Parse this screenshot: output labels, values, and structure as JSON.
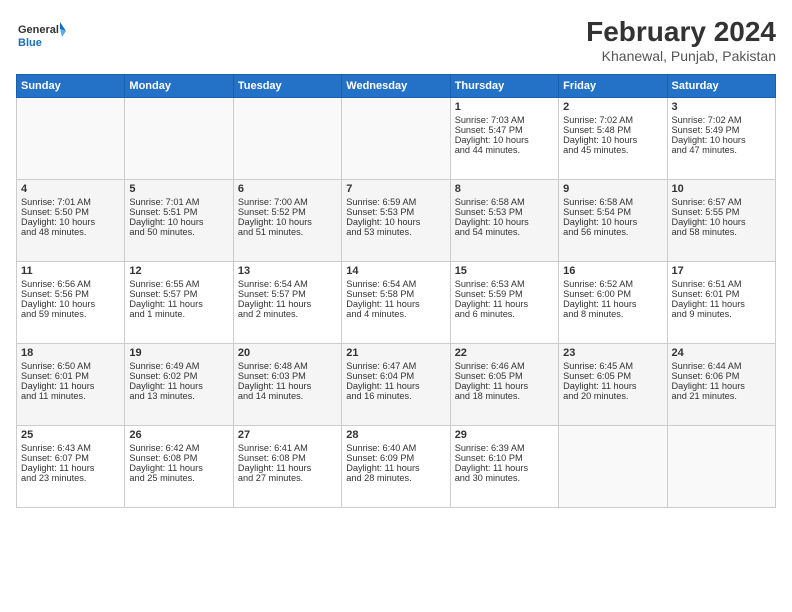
{
  "header": {
    "logo_line1": "General",
    "logo_line2": "Blue",
    "month": "February 2024",
    "location": "Khanewal, Punjab, Pakistan"
  },
  "days_of_week": [
    "Sunday",
    "Monday",
    "Tuesday",
    "Wednesday",
    "Thursday",
    "Friday",
    "Saturday"
  ],
  "weeks": [
    [
      {
        "day": "",
        "content": ""
      },
      {
        "day": "",
        "content": ""
      },
      {
        "day": "",
        "content": ""
      },
      {
        "day": "",
        "content": ""
      },
      {
        "day": "1",
        "content": "Sunrise: 7:03 AM\nSunset: 5:47 PM\nDaylight: 10 hours\nand 44 minutes."
      },
      {
        "day": "2",
        "content": "Sunrise: 7:02 AM\nSunset: 5:48 PM\nDaylight: 10 hours\nand 45 minutes."
      },
      {
        "day": "3",
        "content": "Sunrise: 7:02 AM\nSunset: 5:49 PM\nDaylight: 10 hours\nand 47 minutes."
      }
    ],
    [
      {
        "day": "4",
        "content": "Sunrise: 7:01 AM\nSunset: 5:50 PM\nDaylight: 10 hours\nand 48 minutes."
      },
      {
        "day": "5",
        "content": "Sunrise: 7:01 AM\nSunset: 5:51 PM\nDaylight: 10 hours\nand 50 minutes."
      },
      {
        "day": "6",
        "content": "Sunrise: 7:00 AM\nSunset: 5:52 PM\nDaylight: 10 hours\nand 51 minutes."
      },
      {
        "day": "7",
        "content": "Sunrise: 6:59 AM\nSunset: 5:53 PM\nDaylight: 10 hours\nand 53 minutes."
      },
      {
        "day": "8",
        "content": "Sunrise: 6:58 AM\nSunset: 5:53 PM\nDaylight: 10 hours\nand 54 minutes."
      },
      {
        "day": "9",
        "content": "Sunrise: 6:58 AM\nSunset: 5:54 PM\nDaylight: 10 hours\nand 56 minutes."
      },
      {
        "day": "10",
        "content": "Sunrise: 6:57 AM\nSunset: 5:55 PM\nDaylight: 10 hours\nand 58 minutes."
      }
    ],
    [
      {
        "day": "11",
        "content": "Sunrise: 6:56 AM\nSunset: 5:56 PM\nDaylight: 10 hours\nand 59 minutes."
      },
      {
        "day": "12",
        "content": "Sunrise: 6:55 AM\nSunset: 5:57 PM\nDaylight: 11 hours\nand 1 minute."
      },
      {
        "day": "13",
        "content": "Sunrise: 6:54 AM\nSunset: 5:57 PM\nDaylight: 11 hours\nand 2 minutes."
      },
      {
        "day": "14",
        "content": "Sunrise: 6:54 AM\nSunset: 5:58 PM\nDaylight: 11 hours\nand 4 minutes."
      },
      {
        "day": "15",
        "content": "Sunrise: 6:53 AM\nSunset: 5:59 PM\nDaylight: 11 hours\nand 6 minutes."
      },
      {
        "day": "16",
        "content": "Sunrise: 6:52 AM\nSunset: 6:00 PM\nDaylight: 11 hours\nand 8 minutes."
      },
      {
        "day": "17",
        "content": "Sunrise: 6:51 AM\nSunset: 6:01 PM\nDaylight: 11 hours\nand 9 minutes."
      }
    ],
    [
      {
        "day": "18",
        "content": "Sunrise: 6:50 AM\nSunset: 6:01 PM\nDaylight: 11 hours\nand 11 minutes."
      },
      {
        "day": "19",
        "content": "Sunrise: 6:49 AM\nSunset: 6:02 PM\nDaylight: 11 hours\nand 13 minutes."
      },
      {
        "day": "20",
        "content": "Sunrise: 6:48 AM\nSunset: 6:03 PM\nDaylight: 11 hours\nand 14 minutes."
      },
      {
        "day": "21",
        "content": "Sunrise: 6:47 AM\nSunset: 6:04 PM\nDaylight: 11 hours\nand 16 minutes."
      },
      {
        "day": "22",
        "content": "Sunrise: 6:46 AM\nSunset: 6:05 PM\nDaylight: 11 hours\nand 18 minutes."
      },
      {
        "day": "23",
        "content": "Sunrise: 6:45 AM\nSunset: 6:05 PM\nDaylight: 11 hours\nand 20 minutes."
      },
      {
        "day": "24",
        "content": "Sunrise: 6:44 AM\nSunset: 6:06 PM\nDaylight: 11 hours\nand 21 minutes."
      }
    ],
    [
      {
        "day": "25",
        "content": "Sunrise: 6:43 AM\nSunset: 6:07 PM\nDaylight: 11 hours\nand 23 minutes."
      },
      {
        "day": "26",
        "content": "Sunrise: 6:42 AM\nSunset: 6:08 PM\nDaylight: 11 hours\nand 25 minutes."
      },
      {
        "day": "27",
        "content": "Sunrise: 6:41 AM\nSunset: 6:08 PM\nDaylight: 11 hours\nand 27 minutes."
      },
      {
        "day": "28",
        "content": "Sunrise: 6:40 AM\nSunset: 6:09 PM\nDaylight: 11 hours\nand 28 minutes."
      },
      {
        "day": "29",
        "content": "Sunrise: 6:39 AM\nSunset: 6:10 PM\nDaylight: 11 hours\nand 30 minutes."
      },
      {
        "day": "",
        "content": ""
      },
      {
        "day": "",
        "content": ""
      }
    ]
  ]
}
